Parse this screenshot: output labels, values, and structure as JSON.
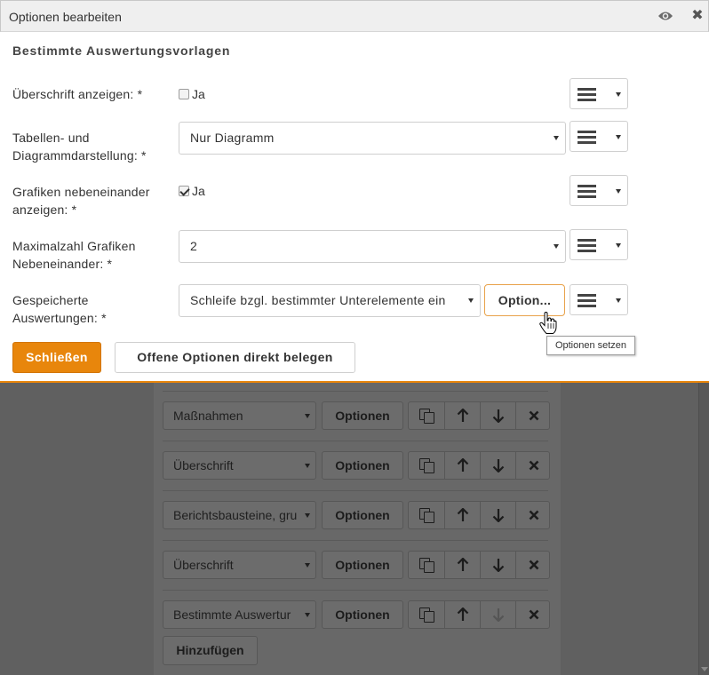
{
  "dialog": {
    "title": "Optionen bearbeiten",
    "icons": [
      "eye-icon",
      "close-icon"
    ],
    "close_glyph": "✖",
    "section_title": "Bestimmte Auswertungsvorlagen",
    "fields": {
      "ueberschrift": {
        "label": "Überschrift anzeigen: *",
        "checkbox_label": "Ja",
        "checked": false
      },
      "tabellen": {
        "label": "Tabellen- und Diagrammdarstellung: *",
        "value": "Nur Diagramm"
      },
      "grafiken": {
        "label": "Grafiken nebeneinander anzeigen: *",
        "checkbox_label": "Ja",
        "checked": true
      },
      "maximalzahl": {
        "label": "Maximalzahl Grafiken Nebeneinander: *",
        "value": "2"
      },
      "gespeicherte": {
        "label": "Gespeicherte Auswertungen: *",
        "value": "Schleife bzgl. bestimmter Unterelemente ein",
        "option_button": "Option...",
        "tooltip": "Optionen setzen"
      }
    },
    "buttons": {
      "close": "Schließen",
      "fill_open": "Offene Optionen direkt belegen"
    }
  },
  "background": {
    "rows": [
      {
        "select": "Maßnahmen",
        "button": "Optionen"
      },
      {
        "select": "Überschrift",
        "button": "Optionen"
      },
      {
        "select": "Berichtsbausteine, gru",
        "button": "Optionen"
      },
      {
        "select": "Überschrift",
        "button": "Optionen"
      },
      {
        "select": "Bestimmte Auswertur",
        "button": "Optionen"
      }
    ],
    "add_button": "Hinzufügen",
    "row_icons": [
      "copy-icon",
      "arrow-up-icon",
      "arrow-down-icon",
      "delete-icon"
    ]
  },
  "colors": {
    "accent": "#e8860c",
    "overlay": "#606060"
  }
}
